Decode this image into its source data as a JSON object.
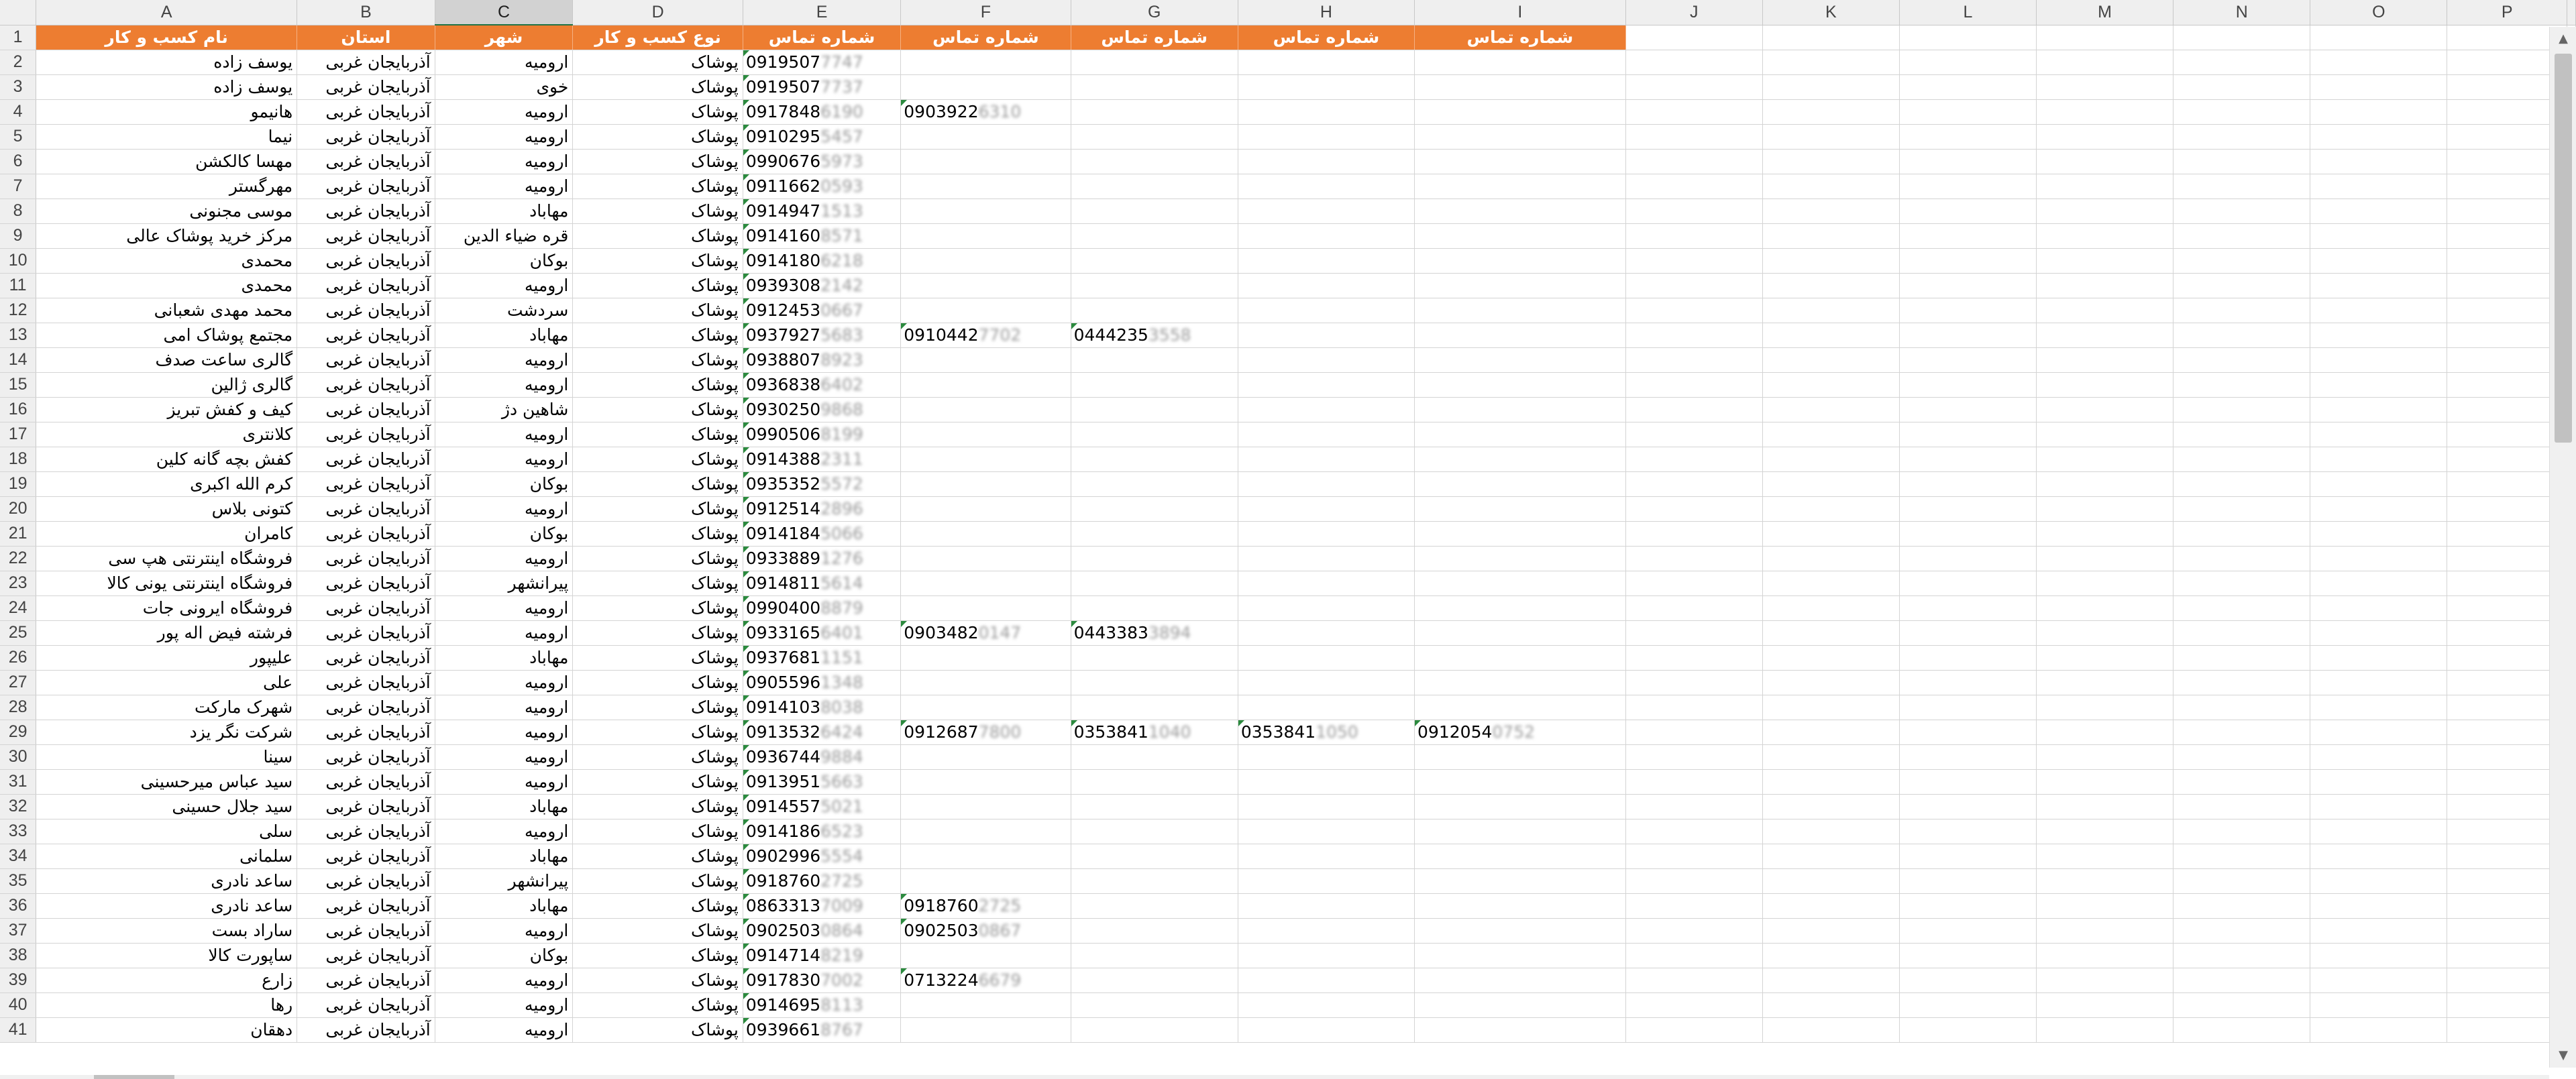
{
  "columns": [
    "A",
    "B",
    "C",
    "D",
    "E",
    "F",
    "G",
    "H",
    "I",
    "J",
    "K",
    "L",
    "M",
    "N",
    "O",
    "P"
  ],
  "selected_column": "C",
  "header_row": [
    "نام کسب و کار",
    "استان",
    "شهر",
    "نوع کسب و کار",
    "شماره تماس",
    "شماره تماس",
    "شماره تماس",
    "شماره تماس",
    "شماره تماس"
  ],
  "rows": [
    {
      "n": "2",
      "name": "یوسف زاده",
      "prov": "آذربایجان غربی",
      "city": "ارومیه",
      "type": "پوشاک",
      "phones": [
        [
          "0919507",
          "7747"
        ]
      ]
    },
    {
      "n": "3",
      "name": "یوسف زاده",
      "prov": "آذربایجان غربی",
      "city": "خوی",
      "type": "پوشاک",
      "phones": [
        [
          "0919507",
          "7737"
        ]
      ]
    },
    {
      "n": "4",
      "name": "هانیمو",
      "prov": "آذربایجان غربی",
      "city": "ارومیه",
      "type": "پوشاک",
      "phones": [
        [
          "0917848",
          "6190"
        ],
        [
          "0903922",
          "6310"
        ]
      ]
    },
    {
      "n": "5",
      "name": "نیما",
      "prov": "آذربایجان غربی",
      "city": "ارومیه",
      "type": "پوشاک",
      "phones": [
        [
          "0910295",
          "5457"
        ]
      ]
    },
    {
      "n": "6",
      "name": "مهسا کالکشن",
      "prov": "آذربایجان غربی",
      "city": "ارومیه",
      "type": "پوشاک",
      "phones": [
        [
          "0990676",
          "5973"
        ]
      ]
    },
    {
      "n": "7",
      "name": "مهرگستر",
      "prov": "آذربایجان غربی",
      "city": "ارومیه",
      "type": "پوشاک",
      "phones": [
        [
          "0911662",
          "0593"
        ]
      ]
    },
    {
      "n": "8",
      "name": "موسی مجنونی",
      "prov": "آذربایجان غربی",
      "city": "مهاباد",
      "type": "پوشاک",
      "phones": [
        [
          "0914947",
          "1513"
        ]
      ]
    },
    {
      "n": "9",
      "name": "مرکز خرید پوشاک عالی",
      "prov": "آذربایجان غربی",
      "city": "قره ضیاء الدین",
      "type": "پوشاک",
      "phones": [
        [
          "0914160",
          "8571"
        ]
      ]
    },
    {
      "n": "10",
      "name": "محمدی",
      "prov": "آذربایجان غربی",
      "city": "بوکان",
      "type": "پوشاک",
      "phones": [
        [
          "0914180",
          "6218"
        ]
      ]
    },
    {
      "n": "11",
      "name": "محمدی",
      "prov": "آذربایجان غربی",
      "city": "ارومیه",
      "type": "پوشاک",
      "phones": [
        [
          "0939308",
          "2142"
        ]
      ]
    },
    {
      "n": "12",
      "name": "محمد مهدی شعبانی",
      "prov": "آذربایجان غربی",
      "city": "سردشت",
      "type": "پوشاک",
      "phones": [
        [
          "0912453",
          "0667"
        ]
      ]
    },
    {
      "n": "13",
      "name": "مجتمع پوشاک امی",
      "prov": "آذربایجان غربی",
      "city": "مهاباد",
      "type": "پوشاک",
      "phones": [
        [
          "0937927",
          "5683"
        ],
        [
          "0910442",
          "7702"
        ],
        [
          "0444235",
          "3558"
        ]
      ]
    },
    {
      "n": "14",
      "name": "گالری ساعت صدف",
      "prov": "آذربایجان غربی",
      "city": "ارومیه",
      "type": "پوشاک",
      "phones": [
        [
          "0938807",
          "8923"
        ]
      ]
    },
    {
      "n": "15",
      "name": "گالری ژالین",
      "prov": "آذربایجان غربی",
      "city": "ارومیه",
      "type": "پوشاک",
      "phones": [
        [
          "0936838",
          "6402"
        ]
      ]
    },
    {
      "n": "16",
      "name": "کیف و کفش تبریز",
      "prov": "آذربایجان غربی",
      "city": "شاهین دژ",
      "type": "پوشاک",
      "phones": [
        [
          "0930250",
          "9868"
        ]
      ]
    },
    {
      "n": "17",
      "name": "کلانتری",
      "prov": "آذربایجان غربی",
      "city": "ارومیه",
      "type": "پوشاک",
      "phones": [
        [
          "0990506",
          "8199"
        ]
      ]
    },
    {
      "n": "18",
      "name": "کفش بچه گانه کلین",
      "prov": "آذربایجان غربی",
      "city": "ارومیه",
      "type": "پوشاک",
      "phones": [
        [
          "0914388",
          "2311"
        ]
      ]
    },
    {
      "n": "19",
      "name": "کرم الله اکبری",
      "prov": "آذربایجان غربی",
      "city": "بوکان",
      "type": "پوشاک",
      "phones": [
        [
          "0935352",
          "5572"
        ]
      ]
    },
    {
      "n": "20",
      "name": "کتونی بلاس",
      "prov": "آذربایجان غربی",
      "city": "ارومیه",
      "type": "پوشاک",
      "phones": [
        [
          "0912514",
          "2896"
        ]
      ]
    },
    {
      "n": "21",
      "name": "کامران",
      "prov": "آذربایجان غربی",
      "city": "بوکان",
      "type": "پوشاک",
      "phones": [
        [
          "0914184",
          "5066"
        ]
      ]
    },
    {
      "n": "22",
      "name": "فروشگاه اینترنتی هپ سی",
      "prov": "آذربایجان غربی",
      "city": "ارومیه",
      "type": "پوشاک",
      "phones": [
        [
          "0933889",
          "1276"
        ]
      ]
    },
    {
      "n": "23",
      "name": "فروشگاه اینترنتی یونی کالا",
      "prov": "آذربایجان غربی",
      "city": "پیرانشهر",
      "type": "پوشاک",
      "phones": [
        [
          "0914811",
          "5614"
        ]
      ]
    },
    {
      "n": "24",
      "name": "فروشگاه ایرونی جات",
      "prov": "آذربایجان غربی",
      "city": "ارومیه",
      "type": "پوشاک",
      "phones": [
        [
          "0990400",
          "8879"
        ]
      ]
    },
    {
      "n": "25",
      "name": "فرشته فیض اله پور",
      "prov": "آذربایجان غربی",
      "city": "ارومیه",
      "type": "پوشاک",
      "phones": [
        [
          "0933165",
          "6401"
        ],
        [
          "0903482",
          "0147"
        ],
        [
          "0443383",
          "3894"
        ]
      ]
    },
    {
      "n": "26",
      "name": "علیپور",
      "prov": "آذربایجان غربی",
      "city": "مهاباد",
      "type": "پوشاک",
      "phones": [
        [
          "0937681",
          "1151"
        ]
      ]
    },
    {
      "n": "27",
      "name": "علی",
      "prov": "آذربایجان غربی",
      "city": "ارومیه",
      "type": "پوشاک",
      "phones": [
        [
          "0905596",
          "1348"
        ]
      ]
    },
    {
      "n": "28",
      "name": "شهرک مارکت",
      "prov": "آذربایجان غربی",
      "city": "ارومیه",
      "type": "پوشاک",
      "phones": [
        [
          "0914103",
          "8038"
        ]
      ]
    },
    {
      "n": "29",
      "name": "شرکت نگر یزد",
      "prov": "آذربایجان غربی",
      "city": "ارومیه",
      "type": "پوشاک",
      "phones": [
        [
          "0913532",
          "6424"
        ],
        [
          "0912687",
          "7800"
        ],
        [
          "0353841",
          "1040"
        ],
        [
          "0353841",
          "1050"
        ],
        [
          "0912054",
          "0752"
        ]
      ]
    },
    {
      "n": "30",
      "name": "سینا",
      "prov": "آذربایجان غربی",
      "city": "ارومیه",
      "type": "پوشاک",
      "phones": [
        [
          "0936744",
          "9884"
        ]
      ]
    },
    {
      "n": "31",
      "name": "سید عباس میرحسینی",
      "prov": "آذربایجان غربی",
      "city": "ارومیه",
      "type": "پوشاک",
      "phones": [
        [
          "0913951",
          "5663"
        ]
      ]
    },
    {
      "n": "32",
      "name": "سید جلال حسینی",
      "prov": "آذربایجان غربی",
      "city": "مهاباد",
      "type": "پوشاک",
      "phones": [
        [
          "0914557",
          "5021"
        ]
      ]
    },
    {
      "n": "33",
      "name": "سلی",
      "prov": "آذربایجان غربی",
      "city": "ارومیه",
      "type": "پوشاک",
      "phones": [
        [
          "0914186",
          "6523"
        ]
      ]
    },
    {
      "n": "34",
      "name": "سلمانی",
      "prov": "آذربایجان غربی",
      "city": "مهاباد",
      "type": "پوشاک",
      "phones": [
        [
          "0902996",
          "5554"
        ]
      ]
    },
    {
      "n": "35",
      "name": "ساعد نادری",
      "prov": "آذربایجان غربی",
      "city": "پیرانشهر",
      "type": "پوشاک",
      "phones": [
        [
          "0918760",
          "2725"
        ]
      ]
    },
    {
      "n": "36",
      "name": "ساعد نادری",
      "prov": "آذربایجان غربی",
      "city": "مهاباد",
      "type": "پوشاک",
      "phones": [
        [
          "0863313",
          "7009"
        ],
        [
          "0918760",
          "2725"
        ]
      ]
    },
    {
      "n": "37",
      "name": "ساراد بست",
      "prov": "آذربایجان غربی",
      "city": "ارومیه",
      "type": "پوشاک",
      "phones": [
        [
          "0902503",
          "0864"
        ],
        [
          "0902503",
          "0867"
        ]
      ]
    },
    {
      "n": "38",
      "name": "ساپورت کالا",
      "prov": "آذربایجان غربی",
      "city": "بوکان",
      "type": "پوشاک",
      "phones": [
        [
          "0914714",
          "8219"
        ]
      ]
    },
    {
      "n": "39",
      "name": "زارع",
      "prov": "آذربایجان غربی",
      "city": "ارومیه",
      "type": "پوشاک",
      "phones": [
        [
          "0917830",
          "7002"
        ],
        [
          "0713224",
          "6679"
        ]
      ]
    },
    {
      "n": "40",
      "name": "رها",
      "prov": "آذربایجان غربی",
      "city": "ارومیه",
      "type": "پوشاک",
      "phones": [
        [
          "0914695",
          "8113"
        ]
      ]
    },
    {
      "n": "41",
      "name": "دهقان",
      "prov": "آذربایجان غربی",
      "city": "ارومیه",
      "type": "پوشاک",
      "phones": [
        [
          "0939661",
          "8767"
        ]
      ]
    }
  ],
  "icons": {
    "scroll_up": "scroll-up-arrow-icon",
    "scroll_down": "scroll-down-arrow-icon"
  },
  "colors": {
    "header_fill": "#ed7d31",
    "header_text": "#ffffff",
    "comment_marker": "#2b8a3e",
    "selection": "#217346"
  }
}
